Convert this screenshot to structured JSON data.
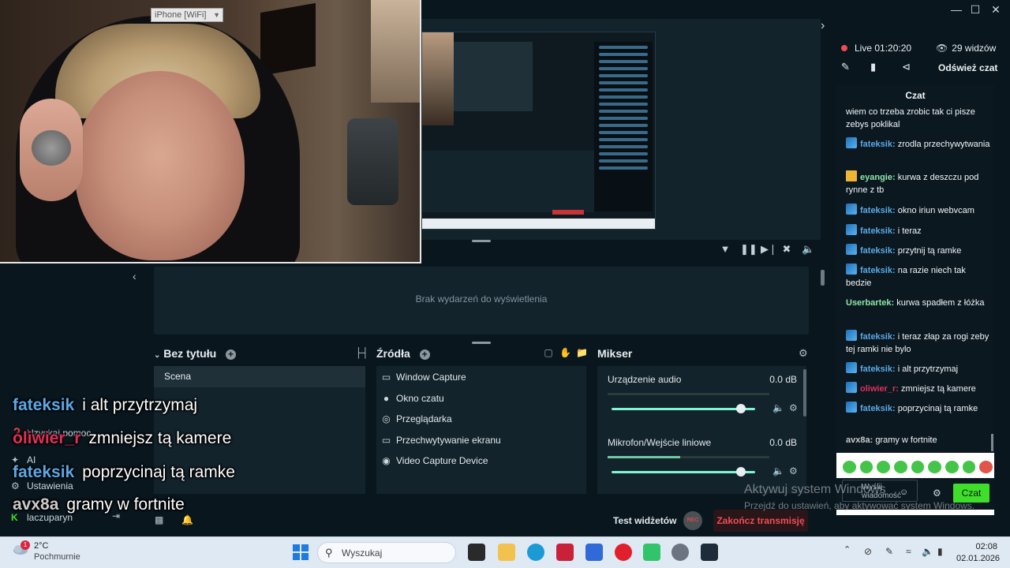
{
  "camera": {
    "device_label": "iPhone [WiFi]"
  },
  "events": {
    "empty_text": "Brak wydarzeń do wyświetlenia"
  },
  "scenes": {
    "title": "Bez tytułu",
    "items": [
      "Scena"
    ]
  },
  "sources": {
    "title": "Źródła",
    "items": [
      {
        "label": "Window Capture",
        "icon": "window-icon"
      },
      {
        "label": "Okno czatu",
        "icon": "chat-icon"
      },
      {
        "label": "Przeglądarka",
        "icon": "globe-icon"
      },
      {
        "label": "Przechwytywanie ekranu",
        "icon": "monitor-icon"
      },
      {
        "label": "Video Capture Device",
        "icon": "webcam-icon"
      }
    ]
  },
  "mixer": {
    "title": "Mikser",
    "channels": [
      {
        "name": "Urządzenie audio",
        "db": "0.0 dB",
        "meter_level": 0.0,
        "volume": 0.9
      },
      {
        "name": "Mikrofon/Wejście liniowe",
        "db": "0.0 dB",
        "meter_level": 0.45,
        "volume": 0.9
      }
    ]
  },
  "left_nav": {
    "items": [
      {
        "label": "Uzyskaj pomoc",
        "icon": "help-icon"
      },
      {
        "label": "AI",
        "icon": "sparkle-icon"
      },
      {
        "label": "Ustawienia",
        "icon": "gear-icon"
      },
      {
        "label": "laczuparyn",
        "icon": "user-icon"
      }
    ]
  },
  "overlay": {
    "lines": [
      {
        "user": "fateksik",
        "text": "i alt przytrzymaj",
        "color": "#5aa9e6"
      },
      {
        "user": "oliwier_r",
        "text": "zmniejsz tą kamere",
        "color": "#e1305a"
      },
      {
        "user": "fateksik",
        "text": "poprzycinaj tą ramke",
        "color": "#5aa9e6"
      },
      {
        "user": "avx8a",
        "text": "gramy w fortnite",
        "color": "#c9c9c9"
      }
    ]
  },
  "bottom_bar": {
    "test_widgets": "Test widżetów",
    "rec": "REC",
    "end_stream": "Zakończ transmisję"
  },
  "stream": {
    "live_label": "Live 01:20:20",
    "viewers": "29 widzów",
    "refresh_chat": "Odśwież czat"
  },
  "chat": {
    "title": "Czat",
    "messages": [
      {
        "user": "",
        "text": "wiem co trzeba zrobic tak ci pisze zebys poklikal",
        "user_color": "#ffffff",
        "badge": ""
      },
      {
        "user": "fateksik",
        "text": "zrodla przechywytwania",
        "user_color": "#5aa9e6",
        "badge": "blue"
      },
      {
        "user": "eyangie",
        "text": "kurwa z deszczu pod rynne z tb",
        "user_color": "#8ee5a6",
        "badge": "crown"
      },
      {
        "user": "fateksik",
        "text": "okno iriun webvcam",
        "user_color": "#5aa9e6",
        "badge": "blue"
      },
      {
        "user": "fateksik",
        "text": "i teraz",
        "user_color": "#5aa9e6",
        "badge": "blue"
      },
      {
        "user": "fateksik",
        "text": "przytnij tą ramke",
        "user_color": "#5aa9e6",
        "badge": "blue"
      },
      {
        "user": "fateksik",
        "text": "na razie niech tak bedzie",
        "user_color": "#5aa9e6",
        "badge": "blue"
      },
      {
        "user": "Userbartek",
        "text": "kurwa spadłem z łóżka",
        "user_color": "#8ee5a6",
        "badge": ""
      },
      {
        "user": "fateksik",
        "text": "i teraz złap za rogi zeby tej ramki nie bylo",
        "user_color": "#5aa9e6",
        "badge": "blue"
      },
      {
        "user": "fateksik",
        "text": "i alt przytrzymaj",
        "user_color": "#5aa9e6",
        "badge": "blue"
      },
      {
        "user": "oliwier_r",
        "text": "zmniejsz tą kamere",
        "user_color": "#e1305a",
        "badge": "blue"
      },
      {
        "user": "fateksik",
        "text": "poprzycinaj tą ramke",
        "user_color": "#5aa9e6",
        "badge": "blue"
      },
      {
        "user": "avx8a",
        "text": "gramy w fortnite",
        "user_color": "#c9c9c9",
        "badge": ""
      }
    ],
    "input_placeholder": "Wyślij wiadomość",
    "send_label": "Czat"
  },
  "watermark": {
    "line1": "Aktywuj system Windows",
    "line2": "Przejdź do ustawień, aby aktywować system Windows."
  },
  "taskbar": {
    "weather_temp": "2°C",
    "weather_desc": "Pochmurnie",
    "weather_badge": "1",
    "search_placeholder": "Wyszukaj",
    "time": "02:08",
    "date": "02.01.2026"
  },
  "colors": {
    "accent_green": "#3ede2b",
    "live_red": "#ef4c55",
    "panel_bg": "#13232b",
    "app_bg": "#09161d"
  }
}
